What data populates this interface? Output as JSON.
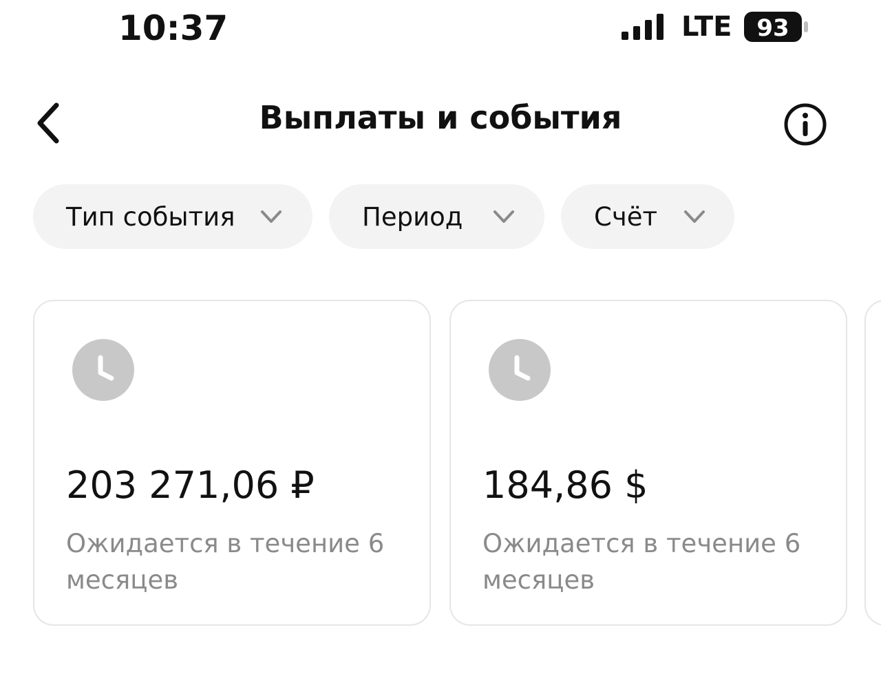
{
  "status_bar": {
    "time": "10:37",
    "network": "LTE",
    "battery": "93"
  },
  "header": {
    "title": "Выплаты и события",
    "back_icon": "chevron-left-icon",
    "info_icon": "info-icon"
  },
  "filters": [
    {
      "label": "Тип события",
      "icon": "chevron-down-icon"
    },
    {
      "label": "Период",
      "icon": "chevron-down-icon"
    },
    {
      "label": "Счёт",
      "icon": "chevron-down-icon"
    }
  ],
  "cards": [
    {
      "icon": "clock-icon",
      "amount": "203 271,06 ₽",
      "note": "Ожидается в течение 6 месяцев"
    },
    {
      "icon": "clock-icon",
      "amount": "184,86 $",
      "note": "Ожидается в течение 6 месяцев"
    }
  ],
  "colors": {
    "chip_background": "#f3f3f3",
    "icon_gray": "#c8c8c8",
    "secondary_text": "#8a8a8a",
    "card_border": "#e6e6e6"
  }
}
